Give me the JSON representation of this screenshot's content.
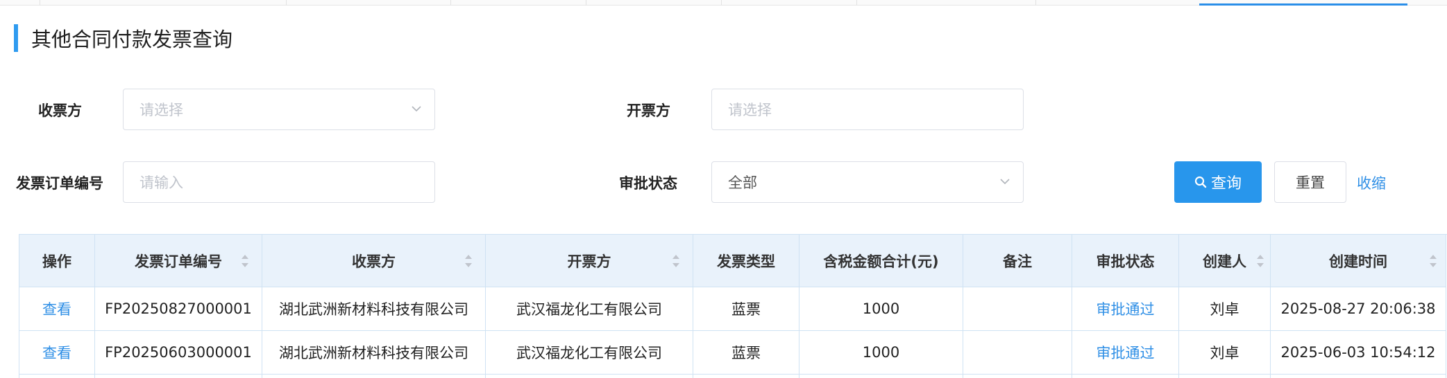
{
  "page": {
    "title": "其他合同付款发票查询"
  },
  "form": {
    "receiver": {
      "label": "收票方",
      "placeholder": "请选择"
    },
    "issuer": {
      "label": "开票方",
      "placeholder": "请选择"
    },
    "order_no": {
      "label": "发票订单编号",
      "placeholder": "请输入"
    },
    "status": {
      "label": "审批状态",
      "value": "全部"
    },
    "query_button": "查询",
    "reset_button": "重置",
    "collapse_link": "收缩"
  },
  "table": {
    "columns": [
      {
        "label": "操作"
      },
      {
        "label": "发票订单编号"
      },
      {
        "label": "收票方"
      },
      {
        "label": "开票方"
      },
      {
        "label": "发票类型"
      },
      {
        "label": "含税金额合计(元)"
      },
      {
        "label": "备注"
      },
      {
        "label": "审批状态"
      },
      {
        "label": "创建人"
      },
      {
        "label": "创建时间"
      }
    ],
    "rows": [
      {
        "action": "查看",
        "order_no": "FP20250827000001",
        "receiver": "湖北武洲新材料科技有限公司",
        "issuer": "武汉福龙化工有限公司",
        "type": "蓝票",
        "amount": "1000",
        "remark": "",
        "status": "审批通过",
        "creator": "刘卓",
        "created": "2025-08-27 20:06:38"
      },
      {
        "action": "查看",
        "order_no": "FP20250603000001",
        "receiver": "湖北武洲新材料科技有限公司",
        "issuer": "武汉福龙化工有限公司",
        "type": "蓝票",
        "amount": "1000",
        "remark": "",
        "status": "审批通过",
        "creator": "刘卓",
        "created": "2025-06-03 10:54:12"
      }
    ]
  },
  "colors": {
    "accent": "#2896ec",
    "header_bg": "#e9f2fb",
    "link": "#2f8fe6"
  }
}
